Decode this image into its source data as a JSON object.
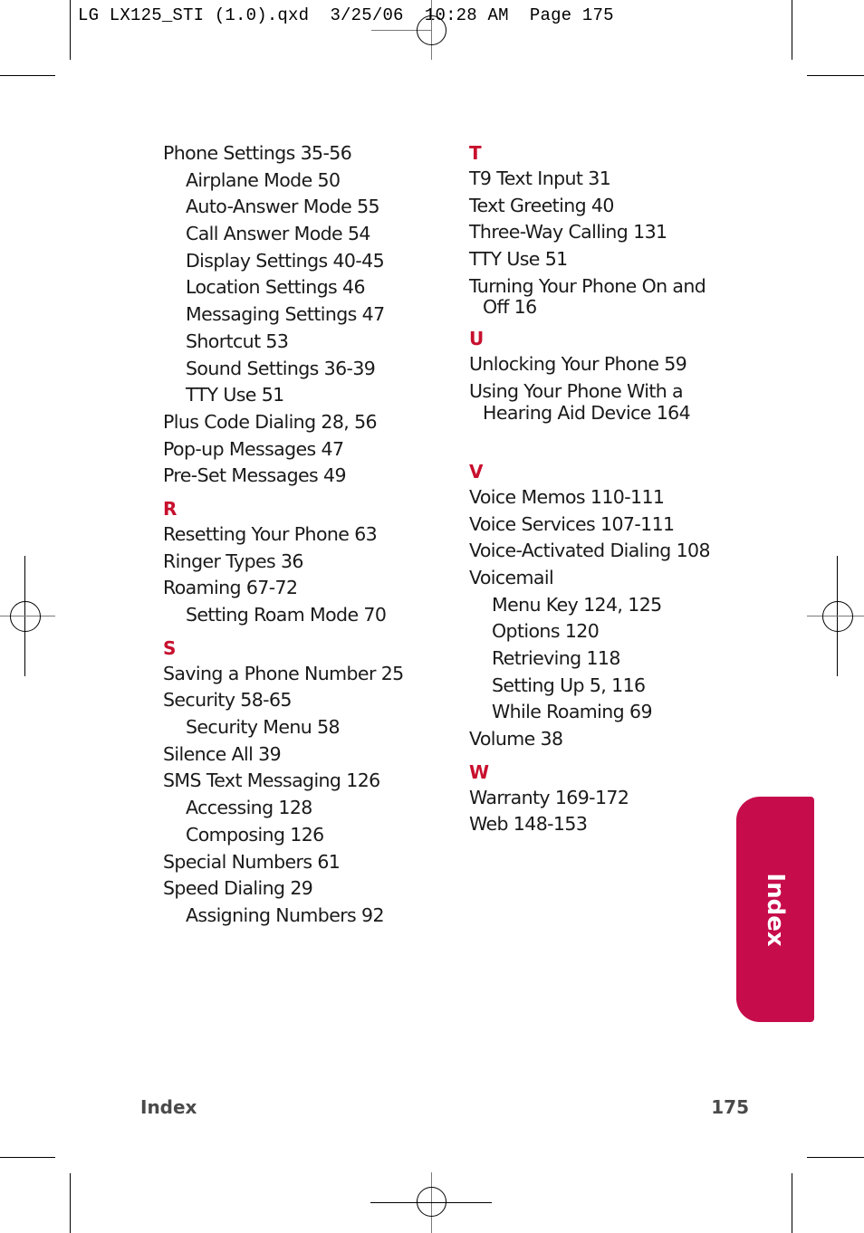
{
  "slug_line": "LG LX125_STI (1.0).qxd  3/25/06  10:28 AM  Page 175",
  "tab": {
    "label": "Index",
    "color": "#c60c4b"
  },
  "accent_color": "#c8102e",
  "footer": {
    "section": "Index",
    "page_number": "175"
  },
  "left_column": [
    {
      "type": "entry",
      "level": 0,
      "text": "Phone Settings 35-56"
    },
    {
      "type": "entry",
      "level": 1,
      "text": "Airplane Mode 50"
    },
    {
      "type": "entry",
      "level": 1,
      "text": "Auto-Answer Mode 55"
    },
    {
      "type": "entry",
      "level": 1,
      "text": "Call Answer Mode 54"
    },
    {
      "type": "entry",
      "level": 1,
      "text": "Display Settings 40-45"
    },
    {
      "type": "entry",
      "level": 1,
      "text": "Location Settings 46"
    },
    {
      "type": "entry",
      "level": 1,
      "text": "Messaging Settings 47"
    },
    {
      "type": "entry",
      "level": 1,
      "text": "Shortcut 53"
    },
    {
      "type": "entry",
      "level": 1,
      "text": "Sound Settings 36-39"
    },
    {
      "type": "entry",
      "level": 1,
      "text": "TTY Use 51"
    },
    {
      "type": "entry",
      "level": 0,
      "text": "Plus Code Dialing 28, 56"
    },
    {
      "type": "entry",
      "level": 0,
      "text": "Pop-up Messages 47"
    },
    {
      "type": "entry",
      "level": 0,
      "text": "Pre-Set Messages 49"
    },
    {
      "type": "letter",
      "text": "R"
    },
    {
      "type": "entry",
      "level": 0,
      "text": "Resetting Your Phone 63"
    },
    {
      "type": "entry",
      "level": 0,
      "text": "Ringer Types 36"
    },
    {
      "type": "entry",
      "level": 0,
      "text": "Roaming 67-72"
    },
    {
      "type": "entry",
      "level": 1,
      "text": "Setting Roam Mode 70"
    },
    {
      "type": "letter",
      "text": "S"
    },
    {
      "type": "entry",
      "level": 0,
      "text": "Saving a Phone Number 25"
    },
    {
      "type": "entry",
      "level": 0,
      "text": "Security 58-65"
    },
    {
      "type": "entry",
      "level": 1,
      "text": "Security Menu 58"
    },
    {
      "type": "entry",
      "level": 0,
      "text": "Silence All 39"
    },
    {
      "type": "entry",
      "level": 0,
      "text": "SMS Text Messaging 126"
    },
    {
      "type": "entry",
      "level": 1,
      "text": "Accessing 128"
    },
    {
      "type": "entry",
      "level": 1,
      "text": "Composing 126"
    },
    {
      "type": "entry",
      "level": 0,
      "text": "Special Numbers 61"
    },
    {
      "type": "entry",
      "level": 0,
      "text": "Speed Dialing 29"
    },
    {
      "type": "entry",
      "level": 1,
      "text": "Assigning Numbers 92"
    }
  ],
  "right_column": [
    {
      "type": "letter",
      "text": "T",
      "first": true
    },
    {
      "type": "entry",
      "level": 0,
      "text": "T9 Text Input 31"
    },
    {
      "type": "entry",
      "level": 0,
      "text": "Text Greeting 40"
    },
    {
      "type": "entry",
      "level": 0,
      "text": "Three-Way Calling 131"
    },
    {
      "type": "entry",
      "level": 0,
      "text": "TTY Use 51"
    },
    {
      "type": "entry",
      "level": 0,
      "text": "Turning Your Phone On and"
    },
    {
      "type": "cont",
      "text": "Off 16"
    },
    {
      "type": "letter",
      "text": "U"
    },
    {
      "type": "entry",
      "level": 0,
      "text": "Unlocking Your Phone 59"
    },
    {
      "type": "entry",
      "level": 0,
      "text": "Using Your Phone With a"
    },
    {
      "type": "cont",
      "text": "Hearing Aid Device 164"
    },
    {
      "type": "gap"
    },
    {
      "type": "letter",
      "text": "V"
    },
    {
      "type": "entry",
      "level": 0,
      "text": "Voice Memos 110-111"
    },
    {
      "type": "entry",
      "level": 0,
      "text": "Voice Services 107-111"
    },
    {
      "type": "entry",
      "level": 0,
      "text": "Voice-Activated Dialing 108"
    },
    {
      "type": "entry",
      "level": 0,
      "text": "Voicemail"
    },
    {
      "type": "entry",
      "level": 1,
      "text": "Menu Key 124, 125"
    },
    {
      "type": "entry",
      "level": 1,
      "text": "Options 120"
    },
    {
      "type": "entry",
      "level": 1,
      "text": "Retrieving 118"
    },
    {
      "type": "entry",
      "level": 1,
      "text": "Setting Up 5, 116"
    },
    {
      "type": "entry",
      "level": 1,
      "text": "While Roaming 69"
    },
    {
      "type": "entry",
      "level": 0,
      "text": "Volume 38"
    },
    {
      "type": "letter",
      "text": "W"
    },
    {
      "type": "entry",
      "level": 0,
      "text": "Warranty 169-172"
    },
    {
      "type": "entry",
      "level": 0,
      "text": "Web 148-153"
    }
  ]
}
